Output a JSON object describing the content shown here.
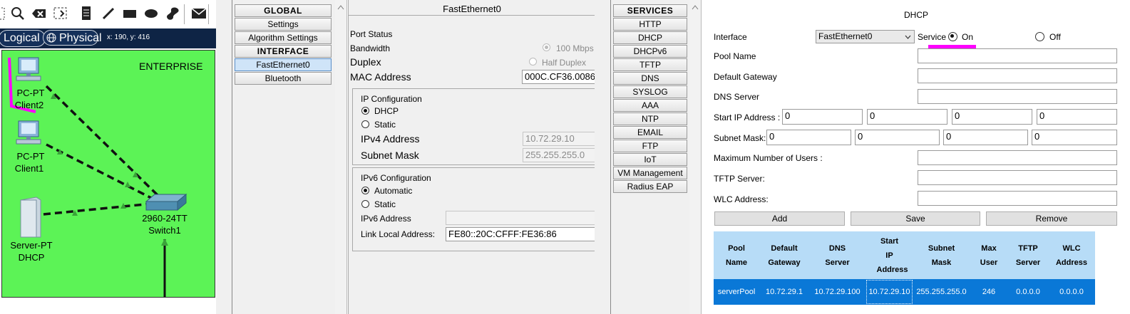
{
  "workspace": {
    "tabs": {
      "logical": "Logical",
      "physical": "Physical"
    },
    "coords": "x: 190, y: 416",
    "area_label": "ENTERPRISE",
    "devices": {
      "client2_type": "PC-PT",
      "client2_name": "Client2",
      "client1_type": "PC-PT",
      "client1_name": "Client1",
      "server_type": "Server-PT",
      "server_name": "DHCP",
      "switch_type": "2960-24TT",
      "switch_name": "Switch1"
    },
    "colors": {
      "canvas": "#5cf356",
      "link": "#111111",
      "link_up": "#3aa33a",
      "annotation": "#ff00ff"
    }
  },
  "config_sidebar": {
    "global_header": "GLOBAL",
    "settings": "Settings",
    "algorithm_settings": "Algorithm Settings",
    "interface_header": "INTERFACE",
    "fastethernet0": "FastEthernet0",
    "bluetooth": "Bluetooth"
  },
  "fe_panel": {
    "title": "FastEthernet0",
    "port_status": "Port Status",
    "bandwidth": "Bandwidth",
    "bandwidth_value": "100 Mbps",
    "duplex": "Duplex",
    "duplex_value": "Half Duplex",
    "mac_label": "MAC Address",
    "mac_value": "000C.CF36.0086",
    "ip_config": {
      "title": "IP Configuration",
      "dhcp": "DHCP",
      "static": "Static",
      "ipv4_label": "IPv4 Address",
      "ipv4_value": "10.72.29.10",
      "mask_label": "Subnet Mask",
      "mask_value": "255.255.255.0"
    },
    "ipv6_config": {
      "title": "IPv6 Configuration",
      "automatic": "Automatic",
      "static": "Static",
      "ipv6_label": "IPv6 Address",
      "ipv6_value": "",
      "link_local_label": "Link Local Address:",
      "link_local_value": "FE80::20C:CFFF:FE36:86"
    }
  },
  "services_sidebar": {
    "header": "SERVICES",
    "items": [
      "HTTP",
      "DHCP",
      "DHCPv6",
      "TFTP",
      "DNS",
      "SYSLOG",
      "AAA",
      "NTP",
      "EMAIL",
      "FTP",
      "IoT",
      "VM Management",
      "Radius EAP"
    ],
    "selected": "DHCP"
  },
  "dhcp": {
    "title": "DHCP",
    "interface_label": "Interface",
    "interface_value": "FastEthernet0",
    "service_label": "Service",
    "on_label": "On",
    "off_label": "Off",
    "pool_name_label": "Pool Name",
    "pool_name_value": "",
    "gateway_label": "Default Gateway",
    "gateway_value": "",
    "dns_label": "DNS Server",
    "dns_value": "",
    "start_ip_label": "Start IP Address :",
    "start_ip": [
      "0",
      "0",
      "0",
      "0"
    ],
    "subnet_label": "Subnet Mask:",
    "subnet": [
      "0",
      "0",
      "0",
      "0"
    ],
    "max_users_label": "Maximum Number of Users :",
    "max_users_value": "",
    "tftp_label": "TFTP Server:",
    "tftp_value": "",
    "wlc_label": "WLC Address:",
    "wlc_value": "",
    "add_button": "Add",
    "save_button": "Save",
    "remove_button": "Remove",
    "table": {
      "headers": [
        "Pool Name",
        "Default Gateway",
        "DNS Server",
        "Start IP Address",
        "Subnet Mask",
        "Max User",
        "TFTP Server",
        "WLC Address"
      ],
      "rows": [
        [
          "serverPool",
          "10.72.29.1",
          "10.72.29.100",
          "10.72.29.10",
          "255.255.255.0",
          "246",
          "0.0.0.0",
          "0.0.0.0"
        ]
      ]
    },
    "colors": {
      "header_bg": "#b7dcf7",
      "selected_row": "#0a78d7"
    }
  }
}
